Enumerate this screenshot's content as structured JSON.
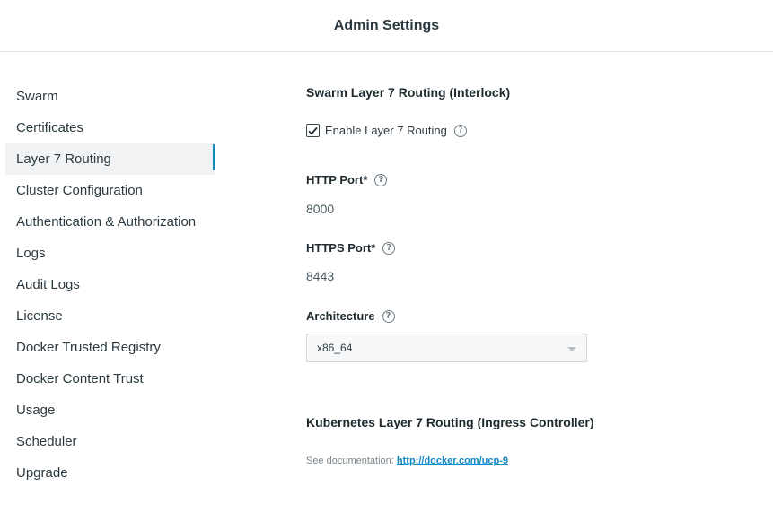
{
  "header": {
    "title": "Admin Settings"
  },
  "sidebar": {
    "active_index": 2,
    "items": [
      {
        "label": "Swarm"
      },
      {
        "label": "Certificates"
      },
      {
        "label": "Layer 7 Routing"
      },
      {
        "label": "Cluster Configuration"
      },
      {
        "label": "Authentication & Authorization"
      },
      {
        "label": "Logs"
      },
      {
        "label": "Audit Logs"
      },
      {
        "label": "License"
      },
      {
        "label": "Docker Trusted Registry"
      },
      {
        "label": "Docker Content Trust"
      },
      {
        "label": "Usage"
      },
      {
        "label": "Scheduler"
      },
      {
        "label": "Upgrade"
      }
    ]
  },
  "main": {
    "swarm_section_title": "Swarm Layer 7 Routing (Interlock)",
    "enable_checkbox": {
      "label": "Enable Layer 7 Routing",
      "checked": true
    },
    "http_port": {
      "label": "HTTP Port*",
      "value": "8000"
    },
    "https_port": {
      "label": "HTTPS Port*",
      "value": "8443"
    },
    "architecture": {
      "label": "Architecture",
      "selected": "x86_64"
    },
    "kubernetes_section_title": "Kubernetes Layer 7 Routing (Ingress Controller)",
    "documentation": {
      "prefix": "See documentation: ",
      "link_text": "http://docker.com/ucp-9"
    }
  },
  "icons": {
    "help": "help-circle-icon",
    "check": "checkmark-icon",
    "dropdown": "chevron-down-icon"
  },
  "colors": {
    "accent": "#1488c6",
    "active_bg": "#f0f2f4"
  }
}
